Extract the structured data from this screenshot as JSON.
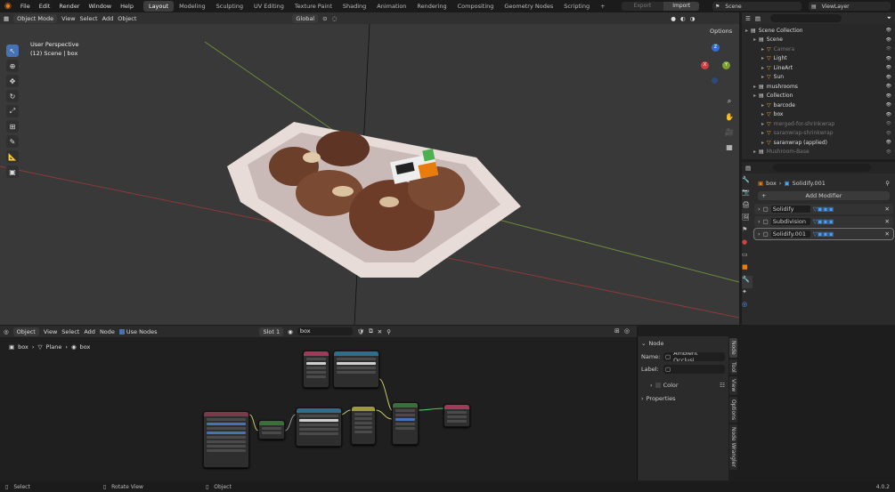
{
  "app": {
    "menus": [
      "File",
      "Edit",
      "Render",
      "Window",
      "Help"
    ],
    "workspaces": [
      "Layout",
      "Modeling",
      "Sculpting",
      "UV Editing",
      "Texture Paint",
      "Shading",
      "Animation",
      "Rendering",
      "Compositing",
      "Geometry Nodes",
      "Scripting"
    ],
    "active_workspace": "Layout",
    "plus": "+",
    "export_label": "Export",
    "import_label": "Import",
    "scene_name": "Scene",
    "view_layer": "ViewLayer"
  },
  "viewport": {
    "mode": "Object Mode",
    "menu": [
      "View",
      "Select",
      "Add",
      "Object"
    ],
    "transform": "Global",
    "options": "Options",
    "info_line1": "User Perspective",
    "info_line2": "(12) Scene | box",
    "gizmo": {
      "x": "X",
      "y": "Y",
      "z": "Z"
    }
  },
  "outliner": {
    "search_placeholder": "",
    "rows": [
      {
        "label": "Scene Collection",
        "indent": 0,
        "dim": false
      },
      {
        "label": "Scene",
        "indent": 1,
        "dim": false
      },
      {
        "label": "Camera",
        "indent": 2,
        "dim": true
      },
      {
        "label": "Light",
        "indent": 2,
        "dim": false
      },
      {
        "label": "LineArt",
        "indent": 2,
        "dim": false
      },
      {
        "label": "Sun",
        "indent": 2,
        "dim": false
      },
      {
        "label": "mushrooms",
        "indent": 1,
        "dim": false
      },
      {
        "label": "Collection",
        "indent": 1,
        "dim": false
      },
      {
        "label": "barcode",
        "indent": 2,
        "dim": false
      },
      {
        "label": "box",
        "indent": 2,
        "dim": false
      },
      {
        "label": "merged-for-shrinkwrap",
        "indent": 2,
        "dim": true
      },
      {
        "label": "saranwrap-shrinkwrap",
        "indent": 2,
        "dim": true
      },
      {
        "label": "saranwrap (applied)",
        "indent": 2,
        "dim": false
      },
      {
        "label": "Mushroom-Base",
        "indent": 1,
        "dim": true
      }
    ]
  },
  "properties": {
    "breadcrumb_object": "box",
    "breadcrumb_modifier": "Solidify.001",
    "add_modifier": "Add Modifier",
    "modifiers": [
      "Solidify",
      "Subdivision",
      "Solidify.001"
    ]
  },
  "node_editor": {
    "type": "Object",
    "menu": [
      "View",
      "Select",
      "Add",
      "Node"
    ],
    "use_nodes": "Use Nodes",
    "slot": "Slot 1",
    "material": "box",
    "breadcrumb": [
      "box",
      "Plane",
      "box"
    ]
  },
  "node_panel": {
    "section": "Node",
    "name_label": "Name:",
    "name_value": "Ambient Occlusi...",
    "label_label": "Label:",
    "label_value": "",
    "color_label": "Color",
    "properties_label": "Properties",
    "tabs": [
      "Node",
      "Tool",
      "View",
      "Options",
      "Node Wrangler"
    ]
  },
  "statusbar": {
    "select": "Select",
    "rotate": "Rotate View",
    "object": "Object",
    "version": "4.0.2"
  }
}
